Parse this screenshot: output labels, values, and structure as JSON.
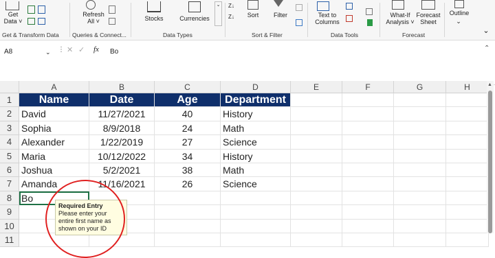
{
  "ribbon": {
    "get_data": "Get\nData ˅",
    "refresh": "Refresh\nAll ˅",
    "stocks": "Stocks",
    "currencies": "Currencies",
    "sort": "Sort",
    "filter": "Filter",
    "text_to_columns": "Text to\nColumns",
    "what_if": "What-If\nAnalysis ˅",
    "forecast_sheet": "Forecast\nSheet",
    "outline": "Outline",
    "groups": [
      "Get & Transform Data",
      "Queries & Connect...",
      "Data Types",
      "Sort & Filter",
      "Data Tools",
      "Forecast"
    ]
  },
  "formula_bar": {
    "name_box": "A8",
    "fx": "fx",
    "value": "Bo"
  },
  "columns": [
    "A",
    "B",
    "C",
    "D",
    "E",
    "F",
    "G",
    "H"
  ],
  "rows": [
    "1",
    "2",
    "3",
    "4",
    "5",
    "6",
    "7",
    "8",
    "9",
    "10",
    "11"
  ],
  "table": {
    "headers": [
      "Name",
      "Date",
      "Age",
      "Department"
    ],
    "rows": [
      [
        "David",
        "11/27/2021",
        "40",
        "History"
      ],
      [
        "Sophia",
        "8/9/2018",
        "24",
        "Math"
      ],
      [
        "Alexander",
        "1/22/2019",
        "27",
        "Science"
      ],
      [
        "Maria",
        "10/12/2022",
        "34",
        "History"
      ],
      [
        "Joshua",
        "5/2/2021",
        "38",
        "Math"
      ],
      [
        "Amanda",
        "11/16/2021",
        "26",
        "Science"
      ]
    ],
    "active_cell_value": "Bo"
  },
  "tooltip": {
    "title": "Required Entry",
    "body": "Please enter your entire first name as shown on your ID"
  },
  "colors": {
    "header_fill": "#0f2f6b",
    "selection": "#1e7145",
    "annotation_circle": "#e02020"
  }
}
